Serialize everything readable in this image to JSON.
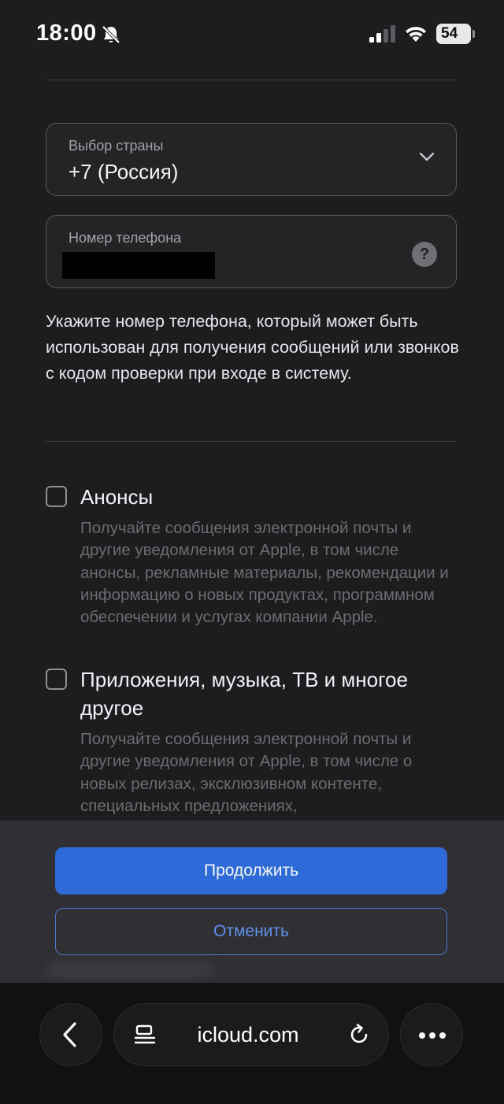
{
  "status_bar": {
    "time": "18:00",
    "battery": "54",
    "icons": [
      "bell-slash-icon",
      "cellular-signal-icon",
      "wifi-icon",
      "battery-icon"
    ]
  },
  "form": {
    "country_label": "Выбор страны",
    "country_value": "+7 (Россия)",
    "phone_label": "Номер телефона",
    "phone_help": "?",
    "hint": "Укажите номер телефона, который может быть использован для получения сообщений или звонков с кодом проверки при входе в систему."
  },
  "checkboxes": [
    {
      "title": "Анонсы",
      "checked": false,
      "description": "Получайте сообщения электронной почты и другие уведомления от Apple, в том числе анонсы, рекламные материалы, рекомендации и информацию о новых продуктах, программном обеспечении и услугах компании Apple."
    },
    {
      "title": "Приложения, музыка, ТВ и многое другое",
      "checked": false,
      "description": "Получайте сообщения электронной почты и другие уведомления от Apple, в том числе о новых релизах, эксклюзивном контенте, специальных предложениях,"
    }
  ],
  "actions": {
    "continue": "Продолжить",
    "cancel": "Отменить"
  },
  "browser": {
    "url": "icloud.com",
    "icons": [
      "back-icon",
      "reader-icon",
      "reload-icon",
      "more-icon"
    ]
  },
  "colors": {
    "background": "#1d1d20",
    "accent": "#2f6ad9",
    "accent_text": "#5f90ea"
  }
}
